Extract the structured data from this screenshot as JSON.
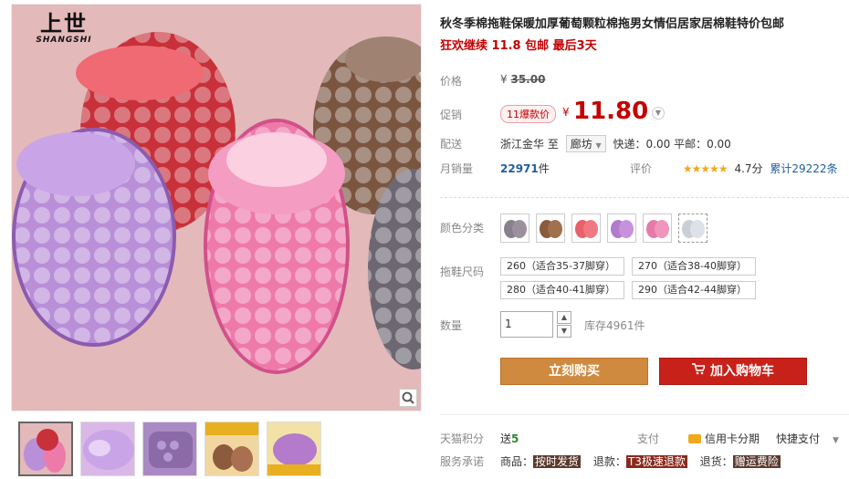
{
  "brand": {
    "cn": "上世",
    "en": "SHANGSHI"
  },
  "product": {
    "title": "秋冬季棉拖鞋保暖加厚葡萄颗粒棉拖男女情侣居家居棉鞋特价包邮",
    "subtitle": "狂欢继续 11.8 包邮 最后3天"
  },
  "price": {
    "label": "价格",
    "original": "35.00",
    "currency": "¥"
  },
  "promo": {
    "label": "促销",
    "tag": "11爆款价",
    "currency": "¥",
    "value": "11.80"
  },
  "shipping": {
    "label": "配送",
    "origin": "浙江金华",
    "to": "至",
    "dest": "廊坊",
    "express": "快递：0.00",
    "mail": "平邮：0.00"
  },
  "sales": {
    "label": "月销量",
    "count": "22971",
    "unit": "件"
  },
  "rating": {
    "label": "评价",
    "stars": "★★★★★",
    "score": "4.7分",
    "total": "累计29222条"
  },
  "colors": {
    "label": "颜色分类",
    "swatches": [
      "#8a7f8c",
      "#8c5a3c",
      "#e8606a",
      "#b47acc",
      "#e57aa8",
      "#c9cfd6"
    ]
  },
  "sizes": {
    "label": "拖鞋尺码",
    "options": [
      "260（适合35-37脚穿）",
      "270（适合38-40脚穿）",
      "280（适合40-41脚穿）",
      "290（适合42-44脚穿）"
    ]
  },
  "quantity": {
    "label": "数量",
    "value": "1",
    "stock": "库存4961件"
  },
  "buttons": {
    "buy": "立刻购买",
    "cart": "加入购物车"
  },
  "points": {
    "label": "天猫积分",
    "prefix": "送",
    "value": "5"
  },
  "payment": {
    "label": "支付",
    "card": "信用卡分期",
    "fast": "快捷支付"
  },
  "services": {
    "label": "服务承诺",
    "goods": "商品：",
    "goods_tag": "按时发货",
    "refund": "退款：",
    "refund_tag": "T3极速退款",
    "return": "退货：",
    "return_tag": "赠运费险"
  },
  "colors_ui": {
    "accent_red": "#c40000",
    "buy_button": "#d08a3f",
    "cart_button": "#c8211a"
  }
}
